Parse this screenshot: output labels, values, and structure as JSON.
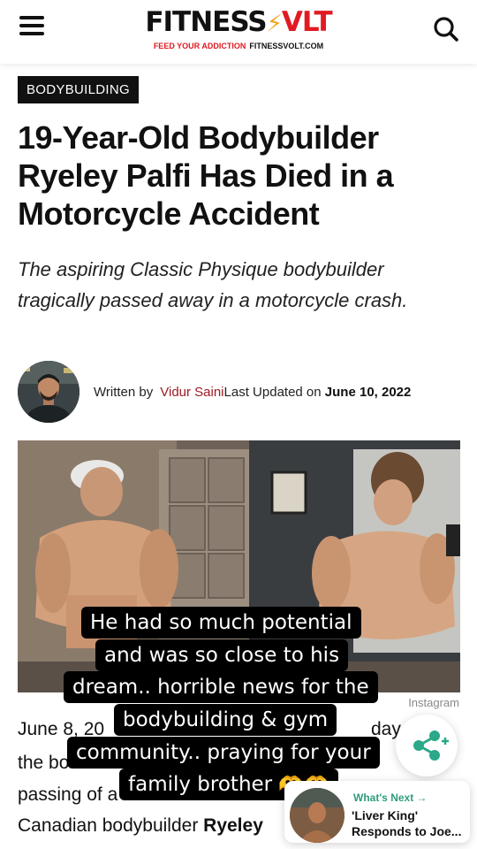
{
  "header": {
    "logo_fitness": "FITNESS",
    "logo_volt": "V",
    "logo_volt_end": "LT",
    "logo_tagline": "FEED YOUR ADDICTION",
    "logo_url": "FITNESSVOLT.COM",
    "menu_icon": "hamburger-icon",
    "search_icon": "search-icon"
  },
  "article": {
    "category": "BODYBUILDING",
    "title": "19-Year-Old Bodybuilder Ryeley Palfi Has Died in a Motorcycle Accident",
    "subtitle": "The aspiring Classic Physique bodybuilder tragically passed away in a motorcycle crash.",
    "written_by": "Written by",
    "author": "Vidur Saini",
    "updated_label": "Last Updated on",
    "updated_date": "June 10, 2022",
    "image_credit": "Instagram",
    "body_lines": [
      "June 8, 20",
      "the bo",
      "passing of a",
      "Canadian bodybuilder "
    ],
    "body_bold": "Ryeley",
    "body_fragment_right": "day"
  },
  "overlay_caption": {
    "lines": [
      "He had so much potential",
      "and was so close to his",
      "dream.. horrible news for the",
      "bodybuilding & gym",
      "community.. praying for your",
      "family brother 🫶🫶"
    ]
  },
  "whats_next": {
    "label": "What's Next →",
    "title": "'Liver King' Responds to Joe..."
  },
  "colors": {
    "brand_red": "#e11a22",
    "author_link": "#9c1b24",
    "whats_next_green": "#2f9d7e",
    "share_teal": "#2aa889"
  }
}
